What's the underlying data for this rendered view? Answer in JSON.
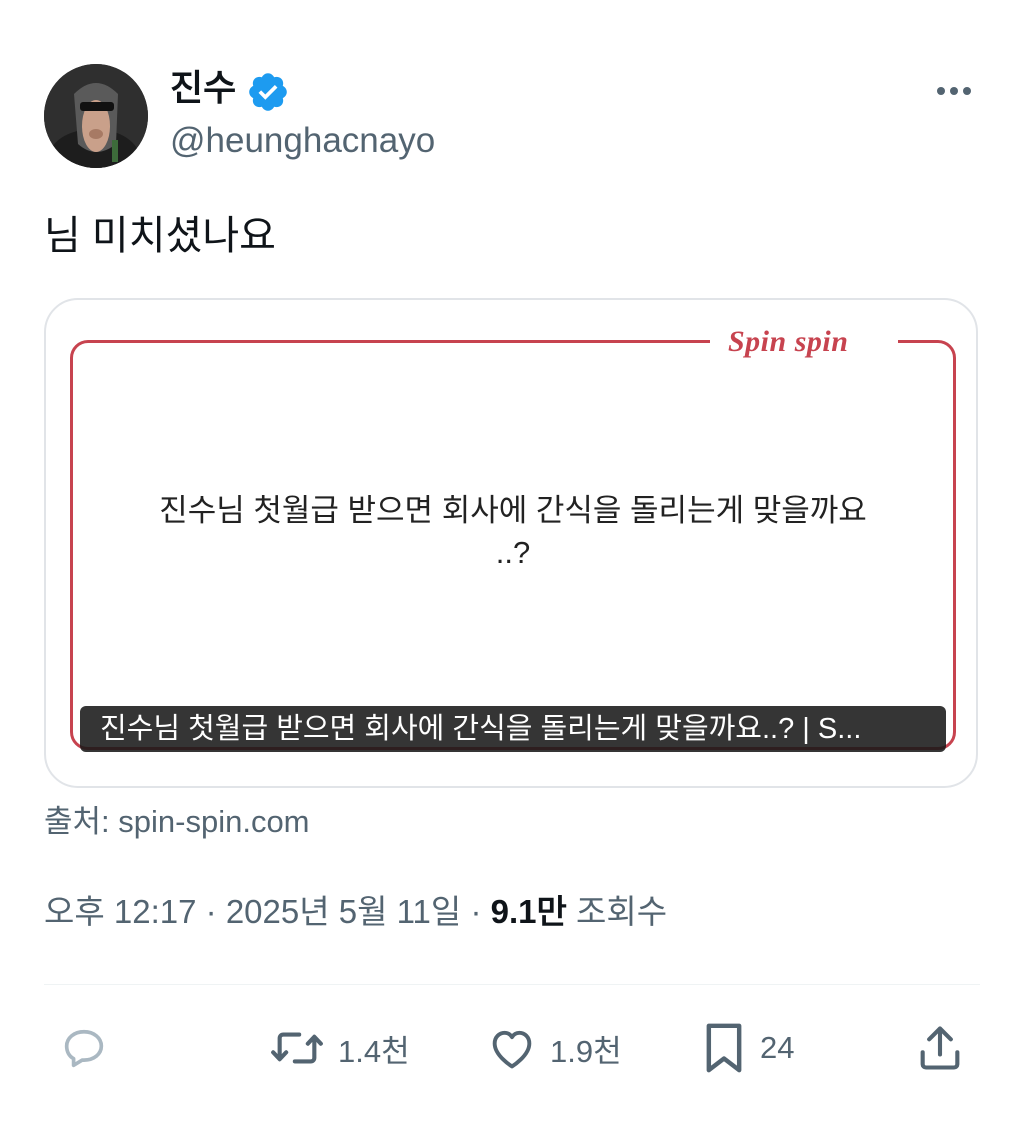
{
  "profile": {
    "display_name": "진수",
    "handle": "@heunghacnayo",
    "verified": true
  },
  "tweet": {
    "text": "님 미치셨나요"
  },
  "card": {
    "logo": "Spin spin",
    "headline": "진수님 첫월급 받으면 회사에 간식을 돌리는게 맞을까요\n..?",
    "caption": "진수님 첫월급 받으면 회사에 간식을 돌리는게 맞을까요..? | S..."
  },
  "source": "출처: spin-spin.com",
  "meta": {
    "time": "오후 12:17",
    "date": "2025년 5월 11일",
    "views": "9.1만",
    "views_label": "조회수"
  },
  "actions": {
    "reply_count": "",
    "retweet_count": "1.4천",
    "like_count": "1.9천",
    "bookmark_count": "24"
  },
  "colors": {
    "verified_blue": "#1d9bf0",
    "card_accent": "#c7434f",
    "secondary_text": "#536471"
  }
}
